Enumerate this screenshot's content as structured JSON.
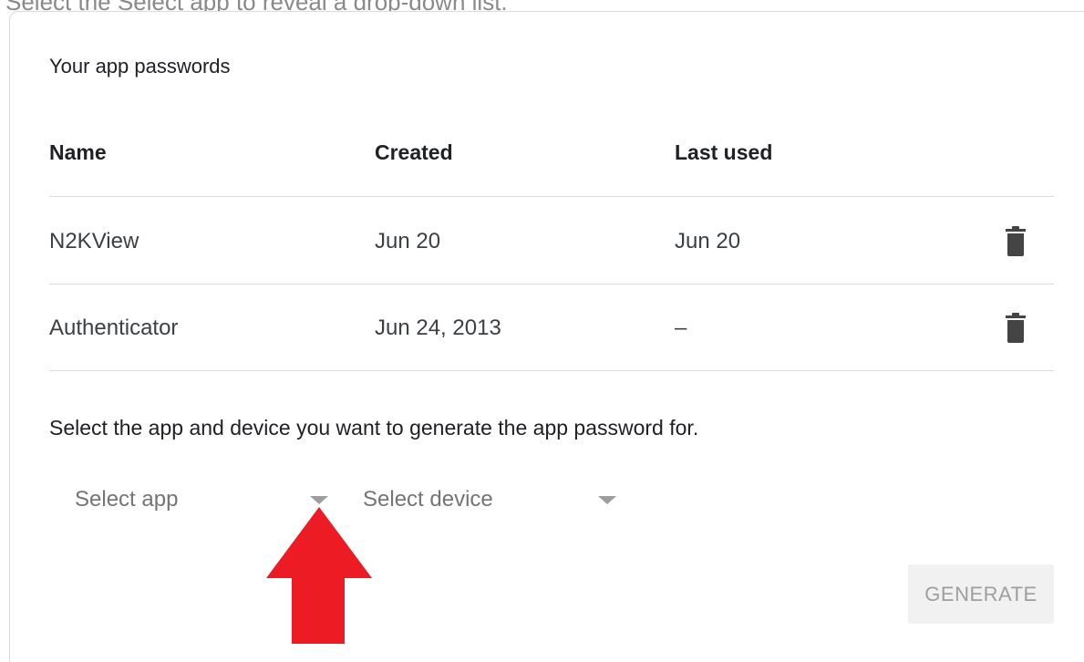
{
  "caption": "Select the Select app to reveal a drop-down list.",
  "section_title": "Your app passwords",
  "table": {
    "headers": {
      "name": "Name",
      "created": "Created",
      "last_used": "Last used"
    },
    "rows": [
      {
        "name": "N2KView",
        "created": "Jun 20",
        "last_used": "Jun 20"
      },
      {
        "name": "Authenticator",
        "created": "Jun 24, 2013",
        "last_used": "–"
      }
    ]
  },
  "instructions": "Select the app and device you want to generate the app password for.",
  "select_app": {
    "label": "Select app"
  },
  "select_device": {
    "label": "Select device"
  },
  "generate_label": "GENERATE",
  "icons": {
    "row_delete": "trash-icon",
    "dropdown": "caret-down-icon",
    "annotation": "up-arrow-icon"
  },
  "colors": {
    "annotation_arrow": "#ed1c24",
    "divider": "#dadce0",
    "muted_text": "#757575"
  }
}
